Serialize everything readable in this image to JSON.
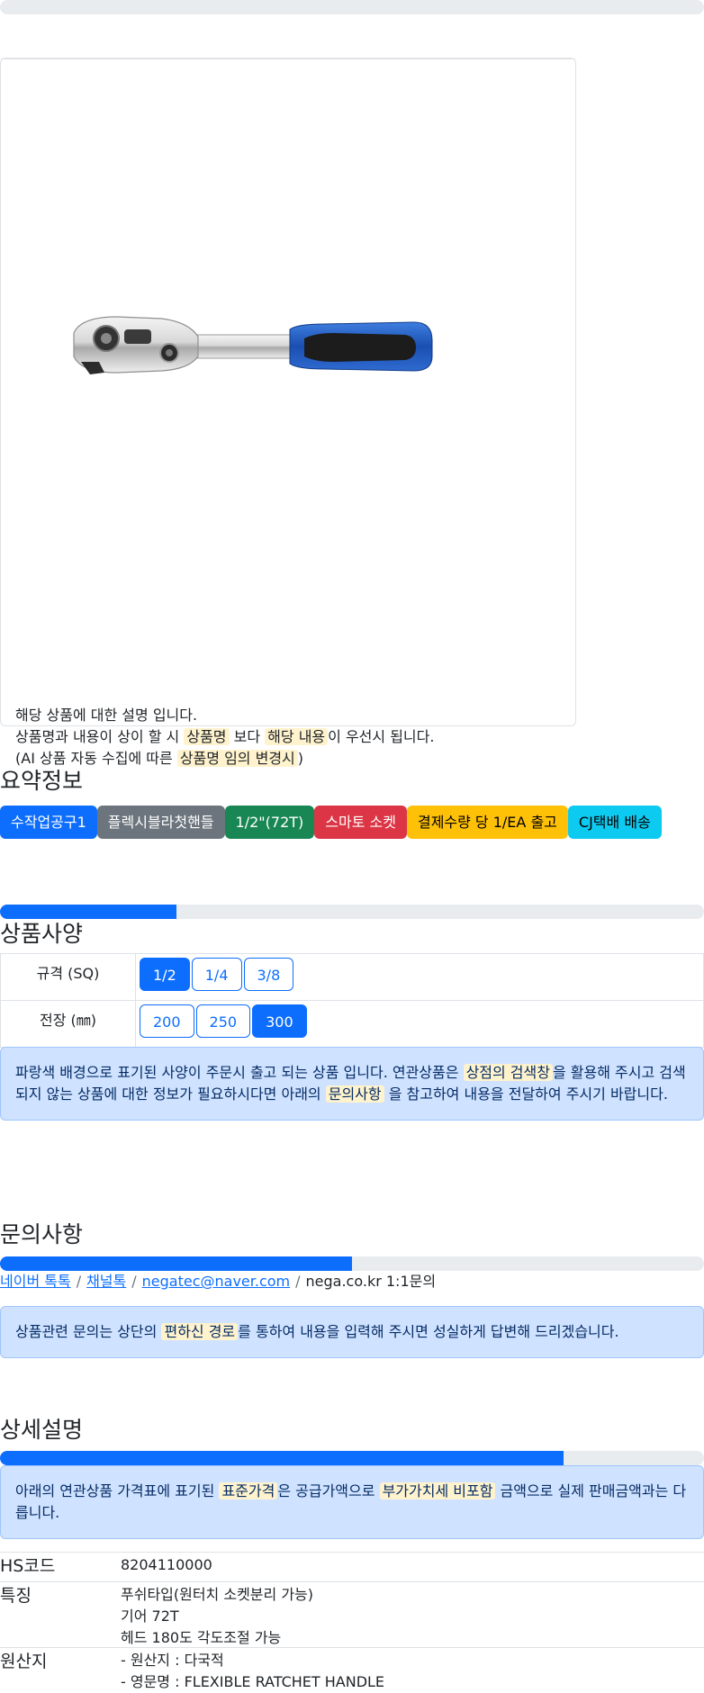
{
  "product": {
    "description": {
      "line1": "해당 상품에 대한 설명 입니다.",
      "line2_pre": "상품명과 내용이 상이 할 시",
      "line2_hl1": "상품명",
      "line2_mid": "보다",
      "line2_hl2": "해당 내용",
      "line2_post": "이 우선시 됩니다.",
      "line3_pre": "(AI 상품 자동 수집에 따른",
      "line3_hl": "상품명 임의 변경시",
      "line3_post": ")"
    }
  },
  "summary": {
    "title": "요약정보",
    "badges": [
      {
        "label": "수작업공구1",
        "color": "#0d6efd"
      },
      {
        "label": "플렉시블라첫핸들",
        "color": "#6c757d"
      },
      {
        "label": "1/2\"(72T)",
        "color": "#198754"
      },
      {
        "label": "스마토 소켓",
        "color": "#dc3545"
      },
      {
        "label": "결제수량 당 1/EA 출고",
        "color": "#ffc107"
      },
      {
        "label": "CJ택배 배송",
        "color": "#0dcaf0"
      }
    ]
  },
  "spec": {
    "title": "상품사양",
    "progress": 0.25,
    "rows": [
      {
        "label": "규격 (SQ)",
        "options": [
          "1/2",
          "1/4",
          "3/8"
        ],
        "selected": "1/2"
      },
      {
        "label": "전장 (㎜)",
        "options": [
          "200",
          "250",
          "300"
        ],
        "selected": "300"
      }
    ],
    "notice": {
      "pre": "파랑색 배경으로 표기된 사양이 주문시 출고 되는 상품 입니다. 연관상품은",
      "hl1": "상점의 검색창",
      "mid": "을 활용해 주시고 검색되지 않는 상품에 대한 정보가 필요하시다면 아래의",
      "hl2": "문의사항",
      "post": "을 참고하여 내용을 전달하여 주시기 바랍니다."
    }
  },
  "inquiry": {
    "title": "문의사항",
    "progress": 0.5,
    "links": [
      "네이버 톡톡",
      "채널톡",
      "negatec@naver.com"
    ],
    "plain": "nega.co.kr 1:1문의",
    "notice": {
      "pre": "상품관련 문의는 상단의",
      "hl": "편하신 경로",
      "post": "를 통하여 내용을 입력해 주시면 성실하게 답변해 드리겠습니다."
    }
  },
  "detail": {
    "title": "상세설명",
    "progress": 0.8,
    "notice": {
      "pre": "아래의 연관상품 가격표에 표기된",
      "hl1": "표준가격",
      "mid": "은 공급가액으로",
      "hl2": "부가가치세 비포함",
      "post": "금액으로 실제 판매금액과는 다릅니다."
    },
    "info": {
      "hs_label": "HS코드",
      "hs_value": "8204110000",
      "feature_label": "특징",
      "features": [
        "푸쉬타입(원터치 소켓분리 가능)",
        "기어 72T",
        "헤드 180도 각도조절 가능"
      ],
      "origin_label": "원산지",
      "origins": [
        "- 원산지 : 다국적",
        "- 영문명 : FLEXIBLE RATCHET HANDLE"
      ]
    }
  },
  "colors": {
    "primary": "#0d6efd",
    "highlight": "#fff3cd",
    "alert_bg": "#cfe2ff"
  }
}
